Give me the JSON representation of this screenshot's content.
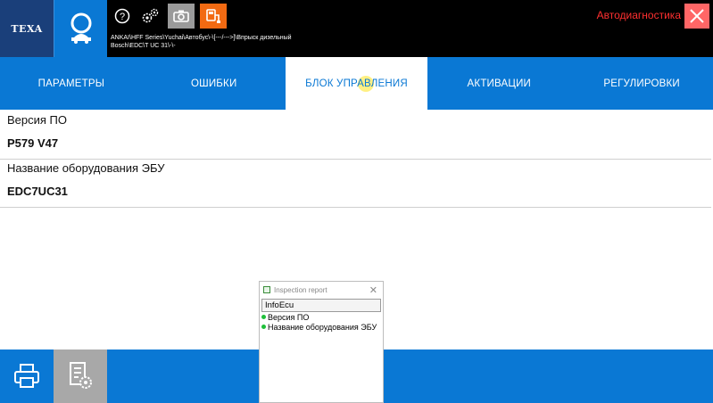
{
  "app": {
    "logo_text": "TEXA",
    "mode_label": "Автодиагностика",
    "path_line1": "ANKAI\\HFF Series\\Yuchai\\Автобус\\-\\[---/--->]\\Впрыск дизельный",
    "path_line2": "Bosch\\EDC\\T UC 31\\-\\-"
  },
  "tabs": [
    {
      "label": "ПАРАМЕТРЫ"
    },
    {
      "label": "ОШИБКИ"
    },
    {
      "label": "БЛОК УПРАВЛЕНИЯ"
    },
    {
      "label": "АКТИВАЦИИ"
    },
    {
      "label": "РЕГУЛИРОВКИ"
    }
  ],
  "info": [
    {
      "label": "Версия ПО",
      "value": "P579 V47"
    },
    {
      "label": "Название оборудования ЭБУ",
      "value": "EDC7UC31"
    }
  ],
  "popup": {
    "title": "Inspection report",
    "header": "InfoEcu",
    "items": [
      "Версия ПО",
      "Название оборудования ЭБУ"
    ]
  },
  "colors": {
    "accent": "#0a78d4",
    "topbar": "#000000",
    "logo_bg": "#1a3f7a",
    "mode_text": "#ff3030",
    "close_bg": "#ff6666",
    "orange_tool": "#f26a12",
    "status_ok": "#1fbf3a"
  },
  "icons": [
    "search-car-icon",
    "help-icon",
    "settings-gears-icon",
    "camera-icon",
    "device-connect-icon",
    "close-icon",
    "printer-icon",
    "document-settings-icon"
  ]
}
